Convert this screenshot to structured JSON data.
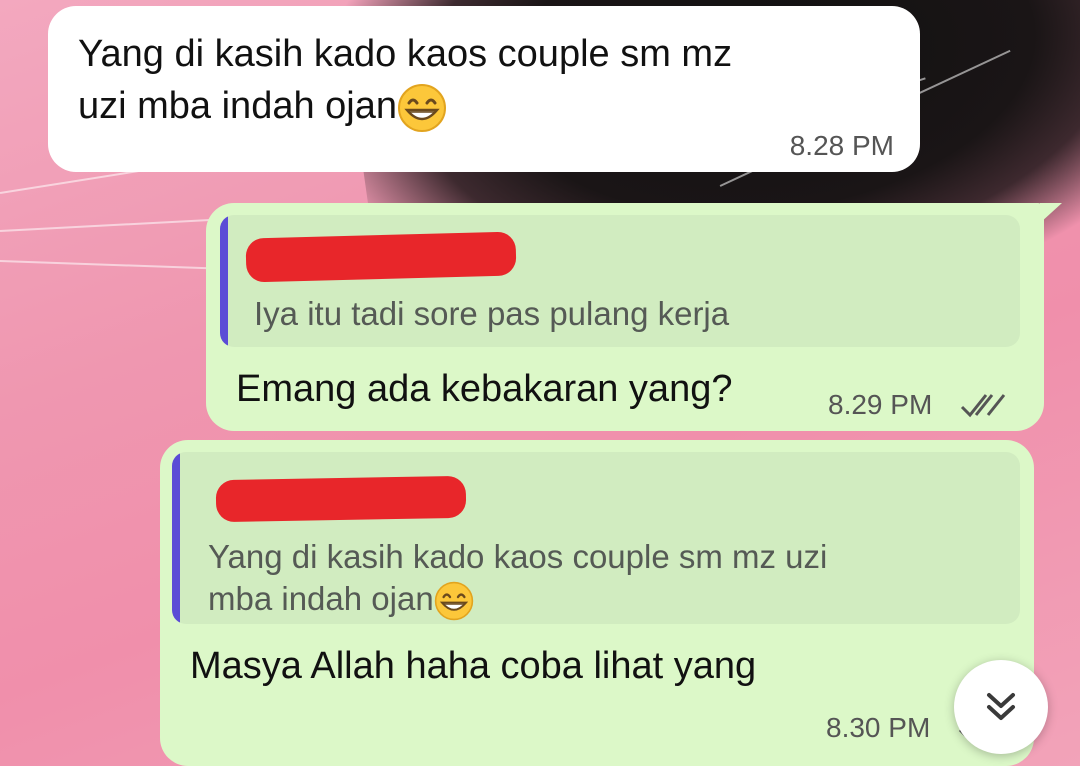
{
  "messages": [
    {
      "direction": "incoming",
      "text_line1": "Yang di kasih kado kaos couple sm mz",
      "text_line2": "uzi mba indah ojan",
      "emoji": "grinning-face-with-smiling-eyes",
      "time": "8.28 PM"
    },
    {
      "direction": "outgoing",
      "quote_text": "Iya itu tadi sore pas pulang kerja",
      "quote_author_redacted": true,
      "text": "Emang ada kebakaran yang?",
      "time": "8.29 PM",
      "status": "read-double-check"
    },
    {
      "direction": "outgoing",
      "quote_text_line1": "Yang di kasih kado kaos couple sm mz uzi",
      "quote_text_line2": "mba indah ojan",
      "quote_emoji": "grinning-face-with-smiling-eyes",
      "quote_author_redacted": true,
      "text": "Masya Allah haha coba lihat yang",
      "time": "8.30 PM",
      "status": "read-double-check"
    }
  ],
  "scroll_button": {
    "icon": "double-chevron-down-icon"
  },
  "colors": {
    "incoming_bubble": "#ffffff",
    "outgoing_bubble": "#dcf8c8",
    "quote_bar": "#5b4cd6",
    "redaction": "#e8262a",
    "wallpaper_pink": "#f29bb3"
  }
}
